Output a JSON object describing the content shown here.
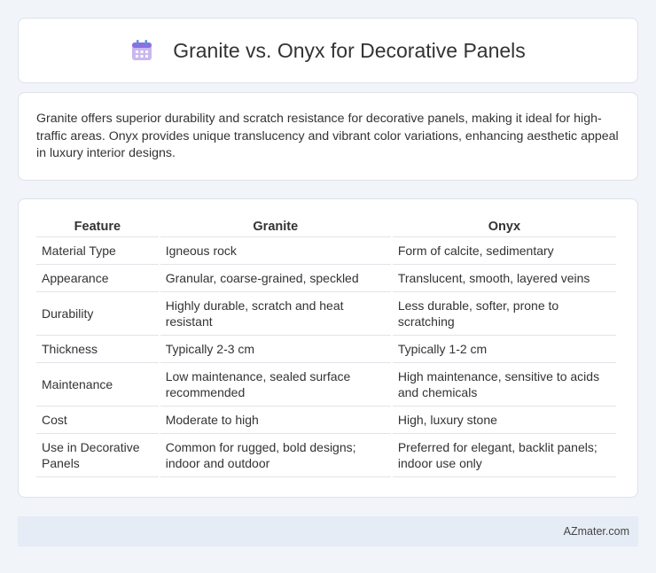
{
  "header": {
    "title": "Granite vs. Onyx for Decorative Panels",
    "icon": "calendar-icon"
  },
  "summary": "Granite offers superior durability and scratch resistance for decorative panels, making it ideal for high-traffic areas. Onyx provides unique translucency and vibrant color variations, enhancing aesthetic appeal in luxury interior designs.",
  "table": {
    "headers": [
      "Feature",
      "Granite",
      "Onyx"
    ],
    "rows": [
      [
        "Material Type",
        "Igneous rock",
        "Form of calcite, sedimentary"
      ],
      [
        "Appearance",
        "Granular, coarse-grained, speckled",
        "Translucent, smooth, layered veins"
      ],
      [
        "Durability",
        "Highly durable, scratch and heat resistant",
        "Less durable, softer, prone to scratching"
      ],
      [
        "Thickness",
        "Typically 2-3 cm",
        "Typically 1-2 cm"
      ],
      [
        "Maintenance",
        "Low maintenance, sealed surface recommended",
        "High maintenance, sensitive to acids and chemicals"
      ],
      [
        "Cost",
        "Moderate to high",
        "High, luxury stone"
      ],
      [
        "Use in Decorative Panels",
        "Common for rugged, bold designs; indoor and outdoor",
        "Preferred for elegant, backlit panels; indoor use only"
      ]
    ]
  },
  "footer": {
    "brand": "AZmater.com"
  }
}
